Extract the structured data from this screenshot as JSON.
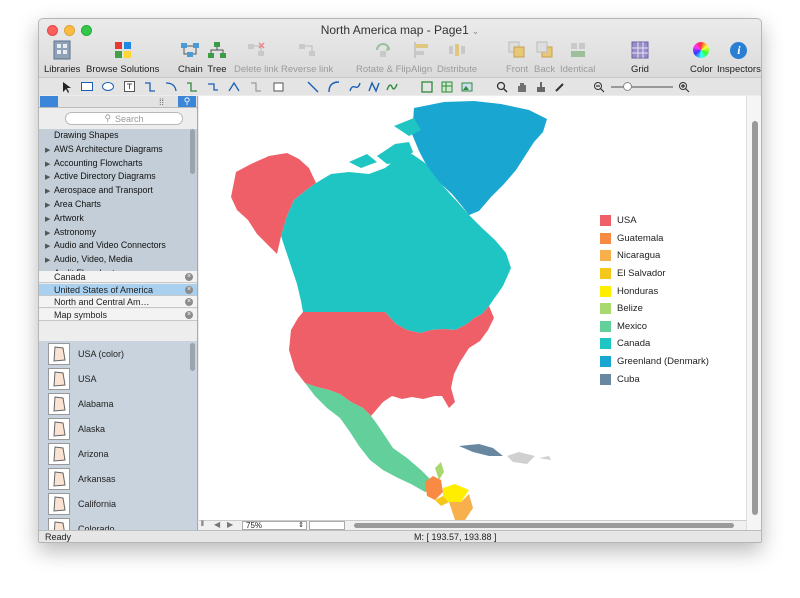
{
  "window": {
    "title": "North America map - Page1"
  },
  "toolbar": {
    "libraries": "Libraries",
    "browse_solutions": "Browse Solutions",
    "chain": "Chain",
    "tree": "Tree",
    "delete_link": "Delete link",
    "reverse_link": "Reverse link",
    "rotate_flip": "Rotate & Flip",
    "align": "Align",
    "distribute": "Distribute",
    "front": "Front",
    "back": "Back",
    "identical": "Identical",
    "grid": "Grid",
    "color": "Color",
    "inspectors": "Inspectors"
  },
  "sidebar": {
    "search_placeholder": "Search",
    "libraries": [
      {
        "label": "Drawing Shapes",
        "expandable": false
      },
      {
        "label": "AWS Architecture Diagrams",
        "expandable": true
      },
      {
        "label": "Accounting Flowcharts",
        "expandable": true
      },
      {
        "label": "Active Directory Diagrams",
        "expandable": true
      },
      {
        "label": "Aerospace and Transport",
        "expandable": true
      },
      {
        "label": "Area Charts",
        "expandable": true
      },
      {
        "label": "Artwork",
        "expandable": true
      },
      {
        "label": "Astronomy",
        "expandable": true
      },
      {
        "label": "Audio and Video Connectors",
        "expandable": true
      },
      {
        "label": "Audio, Video, Media",
        "expandable": true
      },
      {
        "label": "Audit Flowcharts",
        "expandable": true
      }
    ],
    "open_libraries": [
      {
        "label": "Canada",
        "selected": false
      },
      {
        "label": "United States of America",
        "selected": true
      },
      {
        "label": "North and Central Am…",
        "selected": false
      },
      {
        "label": "Map symbols",
        "selected": false
      }
    ],
    "shapes": [
      "USA (color)",
      "USA",
      "Alabama",
      "Alaska",
      "Arizona",
      "Arkansas",
      "California",
      "Colorado"
    ]
  },
  "zoom": {
    "value": "75%"
  },
  "status": {
    "left": "Ready",
    "mouse": "M: [ 193.57, 193.88 ]"
  },
  "legend": [
    {
      "label": "USA",
      "color": "#ef5f67"
    },
    {
      "label": "Guatemala",
      "color": "#f88a43"
    },
    {
      "label": "Nicaragua",
      "color": "#f7b04c"
    },
    {
      "label": "El Salvador",
      "color": "#f5c71a"
    },
    {
      "label": "Honduras",
      "color": "#ffee00"
    },
    {
      "label": "Belize",
      "color": "#a8d86e"
    },
    {
      "label": "Mexico",
      "color": "#63cf9b"
    },
    {
      "label": "Canada",
      "color": "#1ec5c2"
    },
    {
      "label": "Greenland (Denmark)",
      "color": "#19a6d0"
    },
    {
      "label": "Cuba",
      "color": "#6888a2"
    }
  ]
}
